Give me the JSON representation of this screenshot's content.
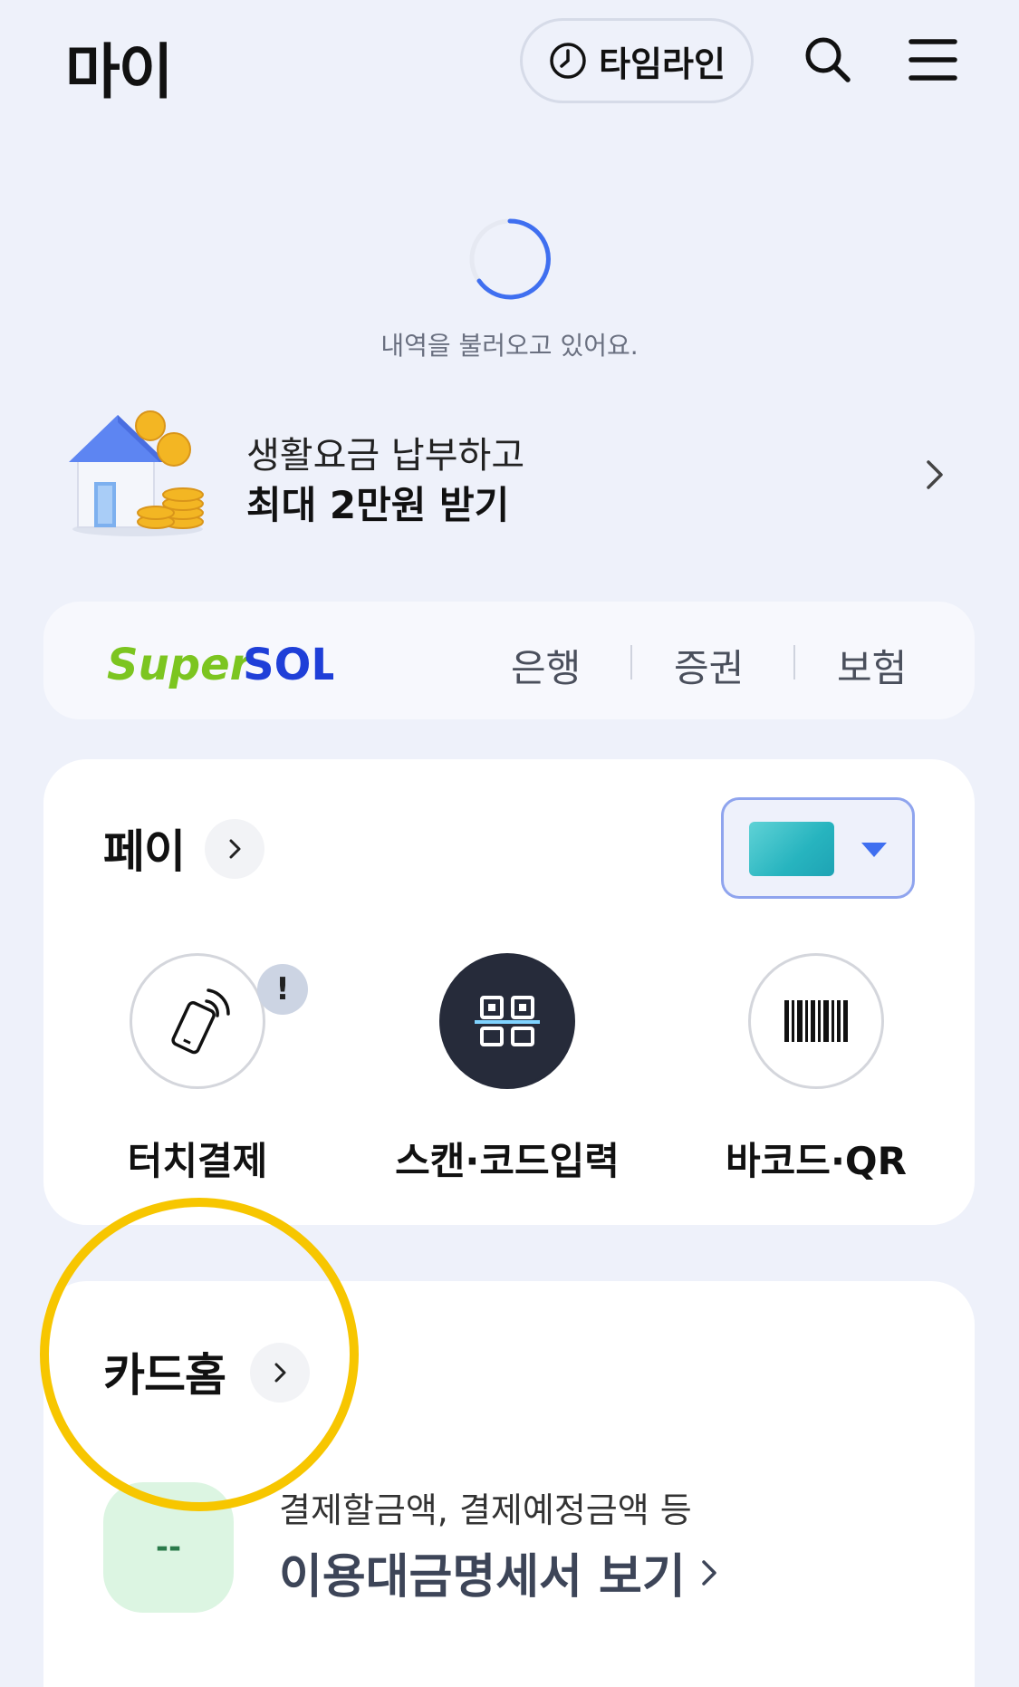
{
  "header": {
    "title": "마이",
    "timeline_label": "타임라인"
  },
  "loading": {
    "text": "내역을 불러오고 있어요."
  },
  "promo": {
    "line1": "생활요금 납부하고",
    "line2": "최대 2만원 받기"
  },
  "supersol": {
    "logo_text_1": "Super",
    "logo_text_2": "SOL",
    "tabs": [
      "은행",
      "증권",
      "보험"
    ]
  },
  "pay": {
    "title": "페이",
    "items": [
      {
        "label": "터치결제",
        "badge": "!"
      },
      {
        "label": "스캔·코드입력"
      },
      {
        "label": "바코드·QR"
      }
    ]
  },
  "cardhome": {
    "title": "카드홈",
    "statement_icon": "--",
    "statement_sub": "결제할금액, 결제예정금액 등",
    "statement_main": "이용대금명세서 보기"
  },
  "colors": {
    "background": "#eef1fa",
    "accent_blue": "#3f6ff0",
    "highlight_yellow": "#f7c600",
    "supersol_green": "#7cc520",
    "supersol_blue": "#1f3fd8"
  }
}
